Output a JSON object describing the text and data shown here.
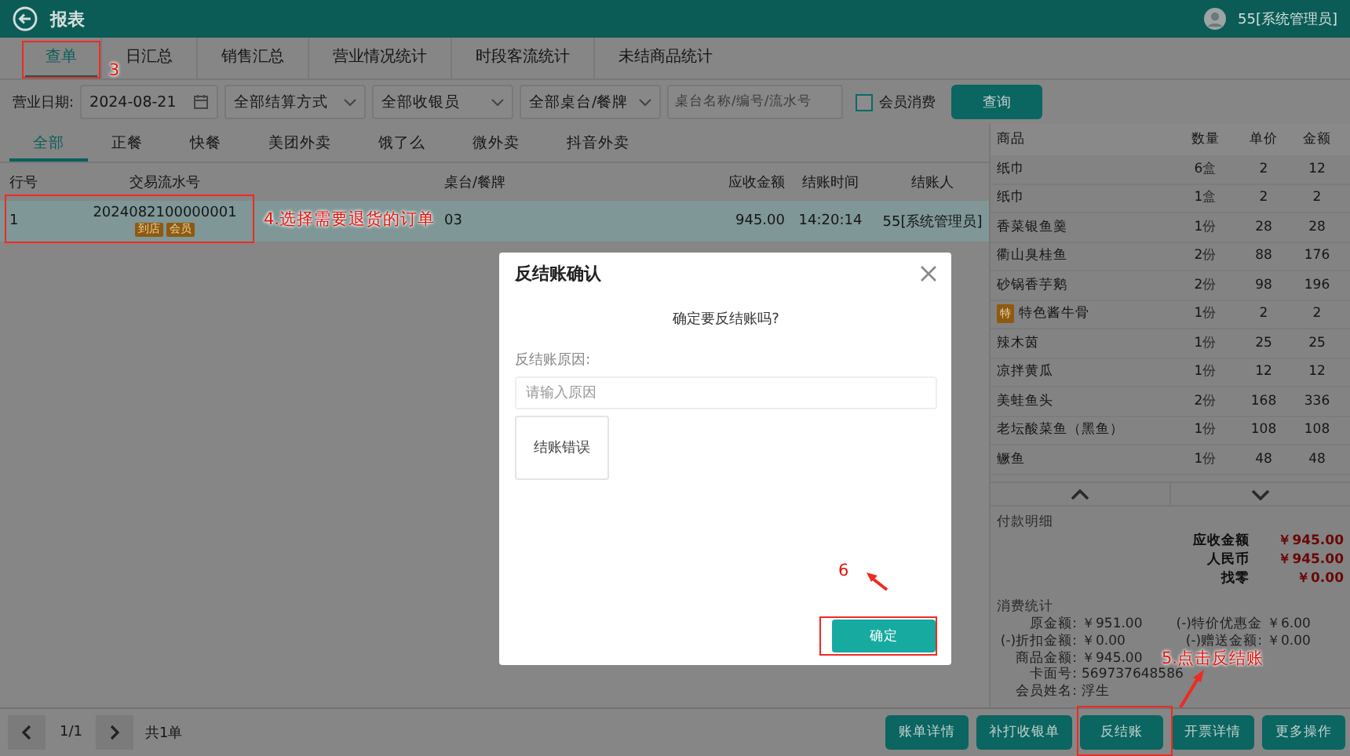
{
  "header": {
    "title": "报表",
    "user": "55[系统管理员]"
  },
  "report_tabs": [
    {
      "label": "查单",
      "selected": true,
      "marked": true,
      "callout": "3"
    },
    {
      "label": "日汇总",
      "selected": false,
      "marked": false
    },
    {
      "label": "销售汇总",
      "selected": false,
      "marked": false
    },
    {
      "label": "营业情况统计",
      "selected": false,
      "marked": false
    },
    {
      "label": "时段客流统计",
      "selected": false,
      "marked": false
    },
    {
      "label": "未结商品统计",
      "selected": false,
      "marked": false
    }
  ],
  "filters": {
    "date_label": "营业日期:",
    "date": "2024-08-21",
    "dropdowns": [
      "全部结算方式",
      "全部收银员",
      "全部桌台/餐牌"
    ],
    "search": {
      "placeholder": "桌台名称/编号/流水号"
    },
    "member_checkbox": {
      "label": "会员消费",
      "checked": false
    },
    "query_button": "查询"
  },
  "order_types": [
    {
      "label": "全部",
      "selected": true
    },
    {
      "label": "正餐",
      "selected": false
    },
    {
      "label": "快餐",
      "selected": false
    },
    {
      "label": "美团外卖",
      "selected": false
    },
    {
      "label": "饿了么",
      "selected": false
    },
    {
      "label": "微外卖",
      "selected": false
    },
    {
      "label": "抖音外卖",
      "selected": false
    }
  ],
  "orders": {
    "columns": [
      "行号",
      "交易流水号",
      "桌台/餐牌",
      "应收金额",
      "结账时间",
      "结账人"
    ],
    "rows": [
      {
        "row_no": "1",
        "serial": "2024082100000001",
        "tags": [
          "到店",
          "会员"
        ],
        "table": "03",
        "amount": "945.00",
        "time": "14:20:14",
        "cashier": "55[系统管理员]",
        "selected": true,
        "marked": true,
        "callout": "4.选择需要退货的订单"
      }
    ]
  },
  "items": {
    "columns": [
      "商品",
      "数量",
      "单价",
      "金额"
    ],
    "rows": [
      {
        "name": "纸巾",
        "qty": "6",
        "unit": "盒",
        "price": "2",
        "amount": "12"
      },
      {
        "name": "纸巾",
        "qty": "1",
        "unit": "盒",
        "price": "2",
        "amount": "2"
      },
      {
        "name": "香菜银鱼羹",
        "qty": "1",
        "unit": "份",
        "price": "28",
        "amount": "28"
      },
      {
        "name": "衢山臭桂鱼",
        "qty": "2",
        "unit": "份",
        "price": "88",
        "amount": "176"
      },
      {
        "name": "砂锅香芋鹅",
        "qty": "2",
        "unit": "份",
        "price": "98",
        "amount": "196"
      },
      {
        "badge": "特",
        "name": "特色酱牛骨",
        "qty": "1",
        "unit": "份",
        "price": "2",
        "amount": "2"
      },
      {
        "name": "辣木茵",
        "qty": "1",
        "unit": "份",
        "price": "25",
        "amount": "25"
      },
      {
        "name": "凉拌黄瓜",
        "qty": "1",
        "unit": "份",
        "price": "12",
        "amount": "12"
      },
      {
        "name": "美蛙鱼头",
        "qty": "2",
        "unit": "份",
        "price": "168",
        "amount": "336"
      },
      {
        "name": "老坛酸菜鱼（黑鱼）",
        "qty": "1",
        "unit": "份",
        "price": "108",
        "amount": "108"
      },
      {
        "name": "鳜鱼",
        "qty": "1",
        "unit": "份",
        "price": "48",
        "amount": "48"
      }
    ]
  },
  "payment": {
    "title": "付款明细",
    "lines": [
      {
        "label": "应收金额",
        "value": "￥945.00"
      },
      {
        "label": "人民币",
        "value": "￥945.00"
      },
      {
        "label": "找零",
        "value": "￥0.00"
      }
    ]
  },
  "consumption": {
    "title": "消费统计",
    "rows": [
      [
        {
          "label": "原金额:",
          "value": "￥951.00"
        },
        {
          "label": "(-)特价优惠金",
          "value": "￥6.00"
        }
      ],
      [
        {
          "label": "(-)折扣金额:",
          "value": "￥0.00"
        },
        {
          "label": "(-)赠送金额:",
          "value": "￥0.00"
        }
      ],
      [
        {
          "label": "商品金额:",
          "value": "￥945.00"
        }
      ],
      [
        {
          "label": "卡面号:",
          "value": "569737648586"
        }
      ],
      [
        {
          "label": "会员姓名:",
          "value": "浮生"
        }
      ]
    ]
  },
  "pager": {
    "page": "1/1",
    "total": "共1单"
  },
  "actions": [
    {
      "label": "账单详情",
      "marked": false
    },
    {
      "label": "补打收银单",
      "marked": false
    },
    {
      "label": "反结账",
      "marked": true,
      "callout": "5.点击反结账"
    },
    {
      "label": "开票详情",
      "marked": false
    },
    {
      "label": "更多操作",
      "marked": false
    }
  ],
  "dialog": {
    "title": "反结账确认",
    "message": "确定要反结账吗?",
    "reason_label": "反结账原因:",
    "reason": {
      "placeholder": "请输入原因"
    },
    "presets": [
      {
        "label": "结账错误",
        "selected": false
      }
    ],
    "confirm": {
      "label": "确定",
      "marked": true,
      "callout": "6"
    }
  }
}
